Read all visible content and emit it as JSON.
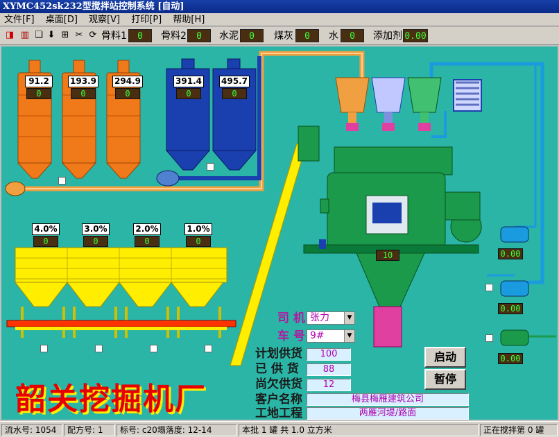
{
  "title": "XYMC452sk232型搅拌站控制系统 [自动]",
  "menu": [
    "文件[F]",
    "桌面[D]",
    "观察[V]",
    "打印[P]",
    "帮助[H]"
  ],
  "toolbar": {
    "items": [
      {
        "label": "骨料1",
        "value": "0"
      },
      {
        "label": "骨料2",
        "value": "0"
      },
      {
        "label": "水泥",
        "value": "0"
      },
      {
        "label": "煤灰",
        "value": "0"
      },
      {
        "label": "水",
        "value": "0"
      },
      {
        "label": "添加剂",
        "value": "0.00"
      }
    ]
  },
  "silos_orange": [
    {
      "weight": "91.2",
      "value": "0"
    },
    {
      "weight": "193.9",
      "value": "0"
    },
    {
      "weight": "294.9",
      "value": "0"
    }
  ],
  "silos_blue": [
    {
      "weight": "391.4",
      "value": "0"
    },
    {
      "weight": "495.7",
      "value": "0"
    }
  ],
  "hoppers": [
    {
      "moisture": "4.0%",
      "value": "0"
    },
    {
      "moisture": "3.0%",
      "value": "0"
    },
    {
      "moisture": "2.0%",
      "value": "0"
    },
    {
      "moisture": "1.0%",
      "value": "0"
    }
  ],
  "mixer_value": "10",
  "pumps": [
    "0.00",
    "0.00",
    "0.00"
  ],
  "form": {
    "driver_label": "司 机",
    "driver_value": "张力",
    "truck_label": "车 号",
    "truck_value": "9#",
    "planned_label": "计划供货",
    "planned_value": "100",
    "supplied_label": "已 供 货",
    "supplied_value": "88",
    "owed_label": "尚欠供货",
    "owed_value": "12",
    "customer_label": "客户名称",
    "customer_value": "梅县梅雁建筑公司",
    "site_label": "工地工程",
    "site_value": "两雁河堤/路面"
  },
  "buttons": {
    "start": "启动",
    "pause": "暂停"
  },
  "company": "韶关挖掘机厂",
  "status": {
    "serial": "流水号: 1054",
    "recipe": "配方号: 1",
    "grade": "标号: c20塌落度: 12-14",
    "batch": "本批 1 罐  共 1.0 立方米",
    "mixing": "正在搅拌第 0 罐"
  },
  "colors": {
    "background": "#2ab5a6",
    "orange_silo": "#f07a1a",
    "blue_silo": "#1a3fae",
    "hopper_yellow": "#ffee00",
    "mixer_green": "#1a9a4a",
    "display_bg": "#4a2e12",
    "display_text": "#3cff3c"
  }
}
